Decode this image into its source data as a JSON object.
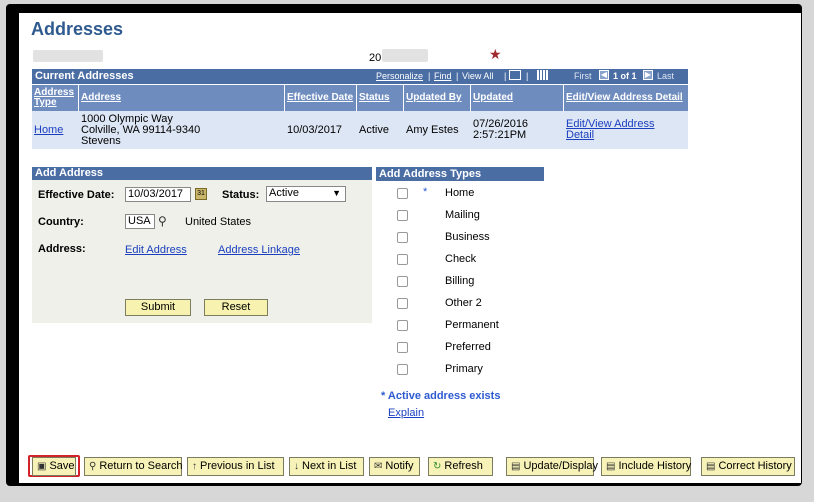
{
  "page": {
    "title": "Addresses",
    "id_prefix": "20",
    "star": "★"
  },
  "grid": {
    "title": "Current Addresses",
    "personalize": "Personalize",
    "find": "Find",
    "view_all": "View All",
    "first": "First",
    "range": "1 of 1",
    "last": "Last",
    "columns": [
      "Address Type",
      "Address",
      "Effective Date",
      "Status",
      "Updated By",
      "Updated",
      "Edit/View Address Detail"
    ],
    "row": {
      "type": "Home",
      "address_line1": "1000 Olympic Way",
      "address_line2": "Colville, WA 99114-9340",
      "address_line3": "Stevens",
      "effective_date": "10/03/2017",
      "status": "Active",
      "updated_by": "Amy Estes",
      "updated_date": "07/26/2016",
      "updated_time": "2:57:21PM",
      "detail_link": "Edit/View Address Detail"
    }
  },
  "add_address": {
    "title": "Add Address",
    "effective_date_label": "Effective Date:",
    "effective_date": "10/03/2017",
    "status_label": "Status:",
    "status": "Active",
    "country_label": "Country:",
    "country_code": "USA",
    "country_name": "United States",
    "address_label": "Address:",
    "edit_address": "Edit Address",
    "address_linkage": "Address Linkage",
    "submit": "Submit",
    "reset": "Reset"
  },
  "address_types": {
    "title": "Add Address Types",
    "items": [
      {
        "label": "Home",
        "marker": "*"
      },
      {
        "label": "Mailing",
        "marker": ""
      },
      {
        "label": "Business",
        "marker": ""
      },
      {
        "label": "Check",
        "marker": ""
      },
      {
        "label": "Billing",
        "marker": ""
      },
      {
        "label": "Other 2",
        "marker": ""
      },
      {
        "label": "Permanent",
        "marker": ""
      },
      {
        "label": "Preferred",
        "marker": ""
      },
      {
        "label": "Primary",
        "marker": ""
      }
    ],
    "note": "* Active address exists",
    "explain": "Explain"
  },
  "toolbar": {
    "save": "Save",
    "return_to_search": "Return to Search",
    "previous_in_list": "Previous in List",
    "next_in_list": "Next in List",
    "notify": "Notify",
    "refresh": "Refresh",
    "update_display": "Update/Display",
    "include_history": "Include History",
    "correct_history": "Correct History"
  },
  "colors": {
    "header_bg": "#4a6da4",
    "colhead_bg": "#6f8cbf",
    "row_bg": "#dde6f4",
    "button_bg": "#f7f2b7",
    "highlight": "#d2232a"
  }
}
